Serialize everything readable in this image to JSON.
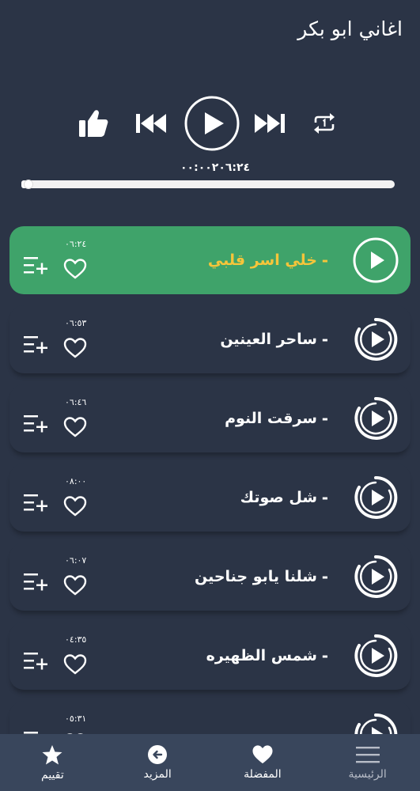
{
  "app": {
    "title": "اغاني ابو بكر"
  },
  "player": {
    "time_display": "٠٠:٠٠٢٠٦:٢٤",
    "progress": 0.01
  },
  "songs": [
    {
      "title": "خلي اسر قلبي",
      "dash": "-",
      "duration": "٠٦:٢٤",
      "active": true
    },
    {
      "title": "ساحر العينين",
      "dash": "-",
      "duration": "٠٦:٥٣",
      "active": false
    },
    {
      "title": "سرقت النوم",
      "dash": "-",
      "duration": "٠٦:٤٦",
      "active": false
    },
    {
      "title": "شل صوتك",
      "dash": "-",
      "duration": "٠٨:٠٠",
      "active": false
    },
    {
      "title": "شلنا يابو جناحين",
      "dash": "-",
      "duration": "٠٦:٠٧",
      "active": false
    },
    {
      "title": "شمس الظهيره",
      "dash": "-",
      "duration": "٠٤:٣٥",
      "active": false
    },
    {
      "title": "",
      "dash": "",
      "duration": "٠٥:٣١",
      "active": false
    }
  ],
  "nav": {
    "home": "الرئيسية",
    "favorites": "المفضلة",
    "more": "المزيد",
    "rate": "تقييم"
  },
  "colors": {
    "background": "#2b3446",
    "active_card": "#3fa36a",
    "active_title": "#f6c53a",
    "nav_bar": "#39465c"
  },
  "icons": [
    "like-icon",
    "previous-icon",
    "play-icon",
    "next-icon",
    "repeat-one-icon",
    "heart-icon",
    "playlist-add-icon",
    "menu-icon",
    "back-arrow-icon",
    "star-icon"
  ]
}
